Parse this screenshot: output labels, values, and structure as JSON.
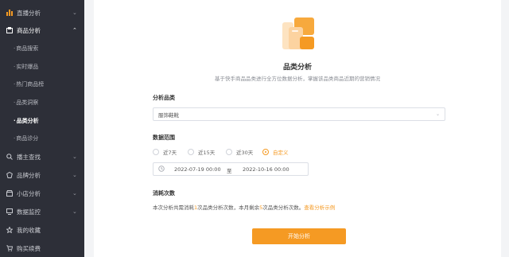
{
  "sidebar": {
    "top_item": {
      "label": "直播分析",
      "icon": "bar-chart-icon"
    },
    "group": {
      "label": "商品分析",
      "icon": "product-icon",
      "subitems": [
        "商品搜索",
        "实时爆品",
        "热门商品榜",
        "品类洞察",
        "品类分析",
        "商品诊分"
      ],
      "current_index": 4
    },
    "items": [
      {
        "label": "播主查找",
        "icon": "search-icon"
      },
      {
        "label": "品牌分析",
        "icon": "brand-icon"
      },
      {
        "label": "小店分析",
        "icon": "shop-icon"
      },
      {
        "label": "数据监控",
        "icon": "monitor-icon"
      },
      {
        "label": "我的收藏",
        "icon": "star-icon"
      },
      {
        "label": "购买续费",
        "icon": "cart-icon"
      }
    ]
  },
  "main": {
    "title": "品类分析",
    "subtitle": "基于快手商品品类进行全方位数据分析，掌握该品类商品近期的营销情况",
    "category": {
      "label": "分析品类",
      "value": "服饰鞋靴"
    },
    "range": {
      "label": "数据范围",
      "options": [
        "近7天",
        "近15天",
        "近30天",
        "自定义"
      ],
      "selected_index": 3,
      "start": "2022-07-19 00:00",
      "separator": "至",
      "end": "2022-10-16 00:00"
    },
    "consume": {
      "label": "消耗次数",
      "text_a": "本次分析共需消耗",
      "count_a": "1",
      "text_b": "次品类分析次数，本月剩余",
      "count_b": "5",
      "text_c": "次品类分析次数。",
      "link": "查看分析示例"
    },
    "start_button": "开始分析"
  },
  "colors": {
    "accent": "#f59a23",
    "sidebar_bg": "#2d2f38"
  }
}
